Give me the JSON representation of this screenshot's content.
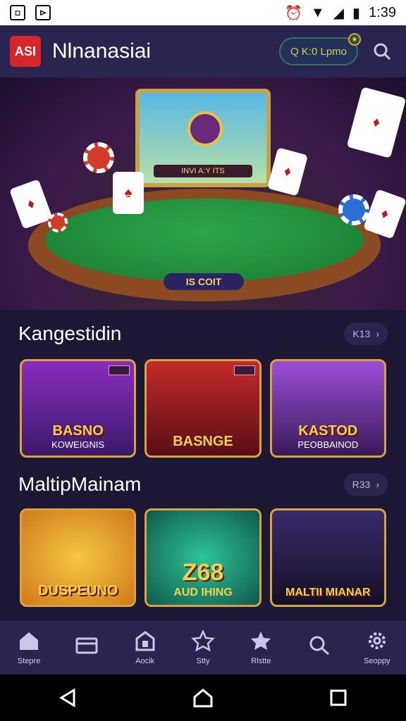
{
  "status_bar": {
    "time": "1:39"
  },
  "header": {
    "logo_text": "ASI",
    "title": "Nlnanasiai",
    "coins_text": "Q K:0 Lpmo",
    "search_icon": "search-icon"
  },
  "hero": {
    "screen_label": "INVI A:Y ITS",
    "table_plate": "IS COIT"
  },
  "sections": [
    {
      "title": "Kangestidin",
      "more_label": "K13",
      "tiles": [
        {
          "logo": "BASNO",
          "sub": "KOWEIGNIS"
        },
        {
          "logo": "BASNGE",
          "sub": ""
        },
        {
          "logo": "KASTOD",
          "sub": "PEOBBAINOD"
        }
      ]
    },
    {
      "title": "MaltipMainam",
      "more_label": "R33",
      "tiles": [
        {
          "logo": "DUSPEUNO",
          "sub": ""
        },
        {
          "logo": "Z68",
          "sub": "AUD IHING"
        },
        {
          "logo": "MALTII MIANAR",
          "sub": ""
        }
      ]
    }
  ],
  "bottom_nav": [
    {
      "label": "Stepre",
      "icon": "home-icon"
    },
    {
      "label": "",
      "icon": "wallet-icon"
    },
    {
      "label": "Aocik",
      "icon": "lock-icon"
    },
    {
      "label": "Stty",
      "icon": "gear-star-icon"
    },
    {
      "label": "Rlstte",
      "icon": "star-icon"
    },
    {
      "label": "",
      "icon": "search-icon"
    },
    {
      "label": "Seoppy",
      "icon": "settings-icon"
    }
  ],
  "colors": {
    "appbar": "#2a2550",
    "accent_gold": "#d8a33e",
    "background": "#1d1736"
  }
}
